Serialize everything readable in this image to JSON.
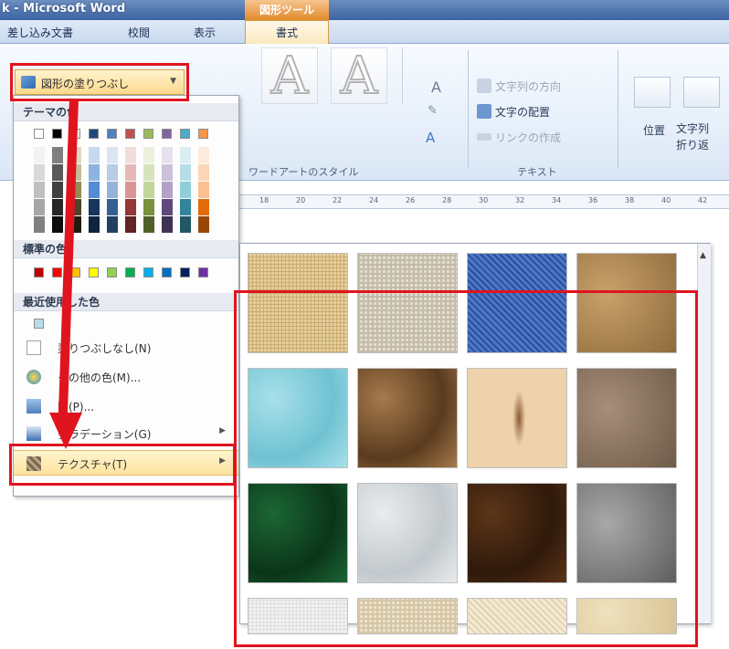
{
  "window": {
    "title": "k - Microsoft Word",
    "contextual_tab_group": "図形ツール"
  },
  "tabs": [
    {
      "label": "差し込み文書"
    },
    {
      "label": "校閲"
    },
    {
      "label": "表示"
    },
    {
      "label": "書式"
    }
  ],
  "ribbon": {
    "wordart_group_label": "ワードアートのスタイル",
    "text_group_label": "テキスト",
    "text_direction": "文字列の方向",
    "text_align": "文字の配置",
    "create_link": "リンクの作成",
    "position": "位置",
    "wrap_text_line1": "文字列",
    "wrap_text_line2": "折り返"
  },
  "ruler_numbers": [
    "18",
    "20",
    "22",
    "24",
    "26",
    "28",
    "30",
    "32",
    "34",
    "36",
    "38",
    "40",
    "42"
  ],
  "fill_button": {
    "label": "図形の塗りつぶし"
  },
  "palette": {
    "theme_colors_label": "テーマの色",
    "standard_colors_label": "標準の色",
    "recent_colors_label": "最近使用した色",
    "theme_top_colors": [
      "#ffffff",
      "#000000",
      "#eeece1",
      "#1f497d",
      "#4f81bd",
      "#c0504d",
      "#9bbb59",
      "#8064a2",
      "#4bacc6",
      "#f79646"
    ],
    "theme_columns": [
      [
        "#f2f2f2",
        "#d9d9d9",
        "#bfbfbf",
        "#a6a6a6",
        "#808080"
      ],
      [
        "#7f7f7f",
        "#595959",
        "#404040",
        "#262626",
        "#0d0d0d"
      ],
      [
        "#ddd9c3",
        "#c4bd97",
        "#948a54",
        "#4a452a",
        "#1d1b10"
      ],
      [
        "#c6d9f0",
        "#8db3e2",
        "#548dd4",
        "#17365d",
        "#0f243e"
      ],
      [
        "#dbe5f1",
        "#b8cce4",
        "#95b3d7",
        "#366092",
        "#244061"
      ],
      [
        "#f2dcdb",
        "#e6b8b7",
        "#da9694",
        "#953734",
        "#632423"
      ],
      [
        "#ebf1dd",
        "#d7e3bc",
        "#c3d69b",
        "#76923c",
        "#4f6128"
      ],
      [
        "#e5e0ec",
        "#ccc1d9",
        "#b2a2c7",
        "#5f497a",
        "#3f3151"
      ],
      [
        "#dbeef3",
        "#b7dde8",
        "#92cddc",
        "#31859b",
        "#205867"
      ],
      [
        "#fdeada",
        "#fbd5b5",
        "#fac08f",
        "#e36c09",
        "#974806"
      ]
    ],
    "standard_colors": [
      "#c00000",
      "#ff0000",
      "#ffc000",
      "#ffff00",
      "#92d050",
      "#00b050",
      "#00b0f0",
      "#0070c0",
      "#002060",
      "#7030a0"
    ],
    "recent_color": "#b7dde8"
  },
  "menu_items": [
    {
      "label": "塗りつぶしなし(N)"
    },
    {
      "label": "その他の色(M)..."
    },
    {
      "label": "図(P)..."
    },
    {
      "label": "グラデーション(G)"
    },
    {
      "label": "テクスチャ(T)"
    }
  ],
  "textures": [
    {
      "name": "canvas-light",
      "base": "#e6cf9c",
      "accent": "#c9ab70"
    },
    {
      "name": "linen-gray",
      "base": "#e2ddd0",
      "accent": "#c4bca8"
    },
    {
      "name": "denim-blue",
      "base": "#4d78c8",
      "accent": "#2b4f98"
    },
    {
      "name": "burlap",
      "base": "#c8a16a",
      "accent": "#8e6a3c"
    },
    {
      "name": "water-droplets",
      "base": "#a8e0ea",
      "accent": "#6fc2d2"
    },
    {
      "name": "brown-paper-bag",
      "base": "#a67a4c",
      "accent": "#5a3b1e"
    },
    {
      "name": "fish-fossil",
      "base": "#edd2ac",
      "accent": "#8b5a33"
    },
    {
      "name": "sand-granite",
      "base": "#a58e7a",
      "accent": "#6f5a48"
    },
    {
      "name": "green-marble",
      "base": "#1b6634",
      "accent": "#0b3519"
    },
    {
      "name": "white-marble",
      "base": "#e9ecee",
      "accent": "#c2c8cc"
    },
    {
      "name": "brown-marble",
      "base": "#5c3518",
      "accent": "#2f190b"
    },
    {
      "name": "granite-gray",
      "base": "#a8a8a8",
      "accent": "#5e5e5e"
    },
    {
      "name": "light-paper",
      "base": "#f2f2f2",
      "accent": "#dedede"
    },
    {
      "name": "parchment",
      "base": "#ece2cc",
      "accent": "#d5c6a5"
    },
    {
      "name": "cream",
      "base": "#f4ead3",
      "accent": "#e2d3b0"
    },
    {
      "name": "pale-canvas",
      "base": "#efe1be",
      "accent": "#d9c596"
    }
  ],
  "annotation_color": "#e0141e"
}
